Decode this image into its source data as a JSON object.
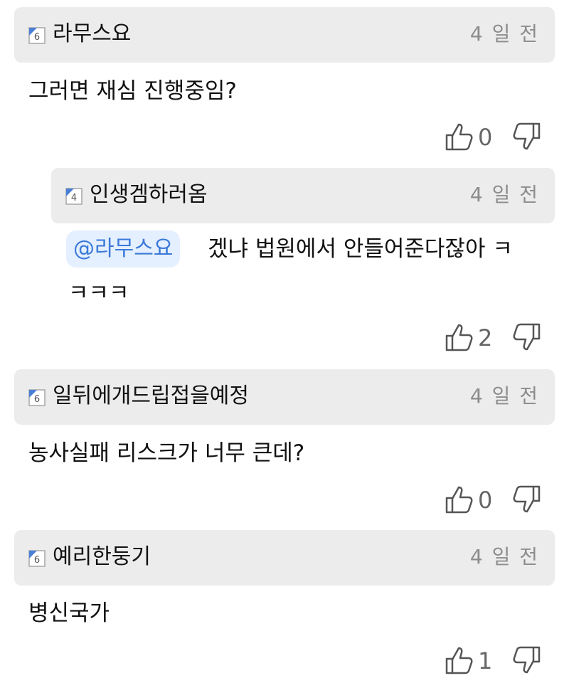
{
  "comments": [
    {
      "level_badge": "6",
      "username": "라무스요",
      "timestamp": "4 일 전",
      "body": "그러면 재심 진행중임?",
      "likes": "0"
    },
    {
      "level_badge": "4",
      "username": "인생겜하러옴",
      "timestamp": "4 일 전",
      "mention": "@라무스요",
      "body_line1": "겠냐 법원에서 안들어준다잖아 ㅋ",
      "body_line2": "ㅋㅋㅋ",
      "likes": "2"
    },
    {
      "level_badge": "6",
      "username": "일뒤에개드립접을예정",
      "timestamp": "4 일 전",
      "body": "농사실패 리스크가 너무 큰데?",
      "likes": "0"
    },
    {
      "level_badge": "6",
      "username": "예리한둥기",
      "timestamp": "4 일 전",
      "body": "병신국가",
      "likes": "1"
    }
  ],
  "colors": {
    "header_bg": "#ececec",
    "mention_bg": "#e4efff",
    "mention_text": "#3b79d8",
    "timestamp": "#8c8c8c",
    "vote_icon": "#555555"
  },
  "icons": {
    "level": "level-badge-icon",
    "like": "thumbs-up-icon",
    "dislike": "thumbs-down-icon"
  }
}
